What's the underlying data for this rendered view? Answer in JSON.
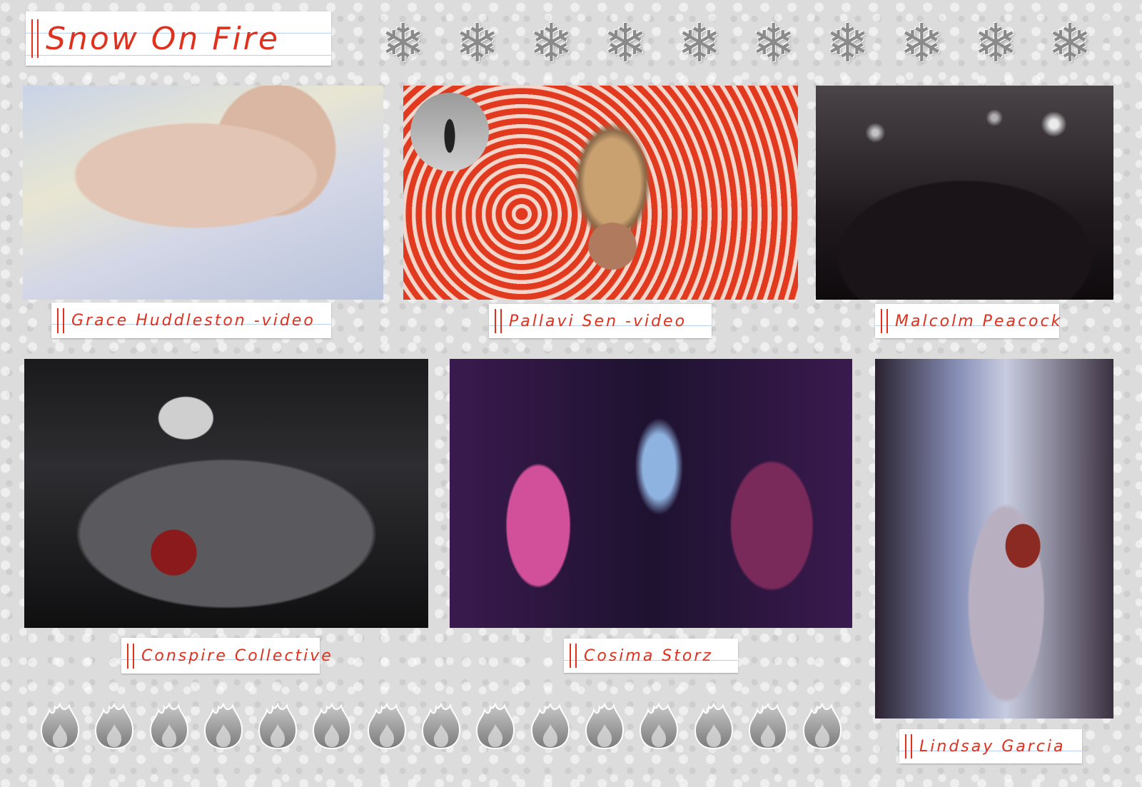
{
  "title": "Snow On Fire",
  "decor": {
    "snowflake_icon": "❄",
    "snowflake_count": 10,
    "flame_icon": "fire-icon",
    "flame_count": 15
  },
  "captions": [
    "Grace Huddleston  -video",
    "Pallavi Sen -video",
    "Malcolm Peacock",
    "Conspire Collective",
    "Cosima Storz",
    "Lindsay Garcia"
  ],
  "colors": {
    "ink": "#e0301e",
    "background": "#dcdcdc"
  }
}
